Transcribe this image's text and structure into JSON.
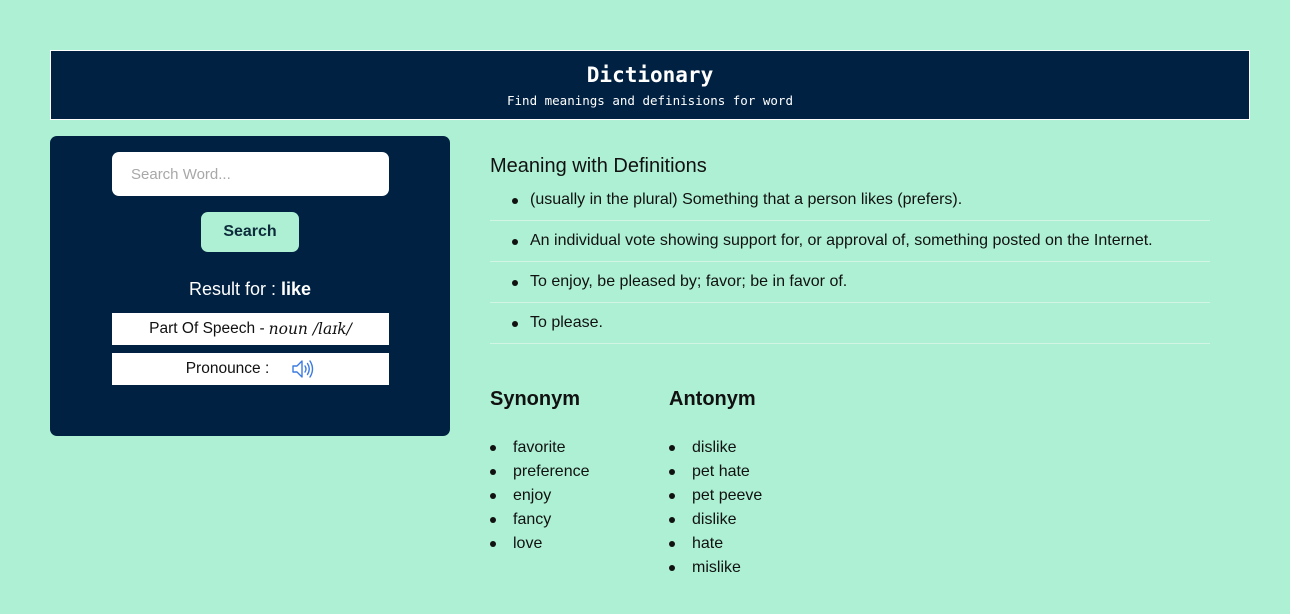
{
  "header": {
    "title": "Dictionary",
    "subtitle": "Find meanings and definisions for word"
  },
  "search": {
    "placeholder": "Search Word...",
    "button_label": "Search"
  },
  "result": {
    "prefix": "Result for :",
    "word": "like",
    "part_of_speech_label": "Part Of Speech -",
    "part_of_speech_value": "noun /laɪk/",
    "pronounce_label": "Pronounce :",
    "speaker_icon": "speaker-icon"
  },
  "meaning": {
    "title": "Meaning with Definitions",
    "definitions": [
      "(usually in the plural) Something that a person likes (prefers).",
      "An individual vote showing support for, or approval of, something posted on the Internet.",
      "To enjoy, be pleased by; favor; be in favor of.",
      "To please."
    ]
  },
  "synonym": {
    "title": "Synonym",
    "items": [
      "favorite",
      "preference",
      "enjoy",
      "fancy",
      "love"
    ]
  },
  "antonym": {
    "title": "Antonym",
    "items": [
      "dislike",
      "pet hate",
      "pet peeve",
      "dislike",
      "hate",
      "mislike"
    ]
  },
  "colors": {
    "background": "#adf0d4",
    "navy": "#002142",
    "button": "#adf0d4"
  }
}
